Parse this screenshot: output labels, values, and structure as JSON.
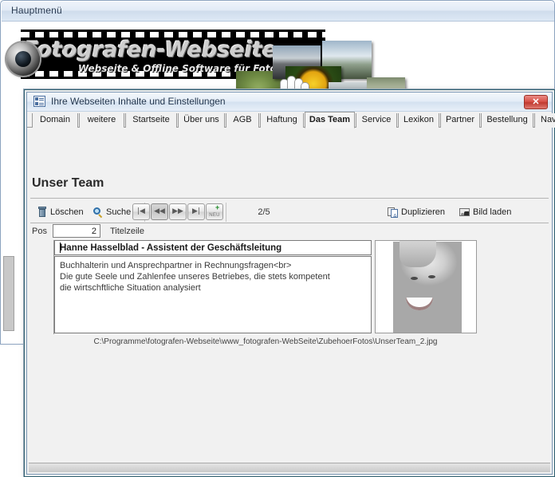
{
  "background_window": {
    "title": "Hauptmenü",
    "banner": {
      "title": "Fotografen-Webseite",
      "subtitle": "Webseite & Offline Software für Fotografen"
    }
  },
  "dialog": {
    "title": "Ihre Webseiten Inhalte und Einstellungen",
    "close_label": "✕",
    "tabs": [
      {
        "label": "Domain",
        "active": false
      },
      {
        "label": "weitere",
        "active": false
      },
      {
        "label": "Startseite",
        "active": false
      },
      {
        "label": "Über uns",
        "active": false
      },
      {
        "label": "AGB",
        "active": false
      },
      {
        "label": "Haftung",
        "active": false
      },
      {
        "label": "Das Team",
        "active": true
      },
      {
        "label": "Service",
        "active": false
      },
      {
        "label": "Lexikon",
        "active": false
      },
      {
        "label": "Partner",
        "active": false
      },
      {
        "label": "Bestellung",
        "active": false
      },
      {
        "label": "Navigation",
        "active": false
      }
    ],
    "page": {
      "heading": "Unser Team",
      "toolbar": {
        "delete_label": "Löschen",
        "search_label": "Suche",
        "nav_first": "|◀",
        "nav_prev": "◀◀",
        "nav_next": "▶▶",
        "nav_last": "▶|",
        "nav_new_label": "NEU",
        "nav_new_plus": "+",
        "record_counter": "2/5",
        "duplicate_label": "Duplizieren",
        "load_image_label": "Bild laden"
      },
      "fields": {
        "pos_label": "Pos",
        "pos_value": "2",
        "titlezeile_label": "Titelzeile",
        "title_value": "Hanne Hasselblad - Assistent der Geschäftsleitung",
        "body_line1": "Buchhalterin und Ansprechpartner in Rechnungsfragen<br>",
        "body_line2": "Die gute Seele und Zahlenfee unseres Betriebes, die stets kompetent",
        "body_line3": "die wirtschftliche Situation analysiert",
        "image_path": "C:\\Programme\\fotografen-Webseite\\www_fotografen-WebSeite\\ZubehoerFotos\\UnserTeam_2.jpg"
      }
    }
  },
  "colors": {
    "dialog_bg": "#f1f1f1",
    "titlebar_blue": "#d4e1f0",
    "close_red": "#d9534a",
    "accent_border": "#2f5f6f"
  }
}
